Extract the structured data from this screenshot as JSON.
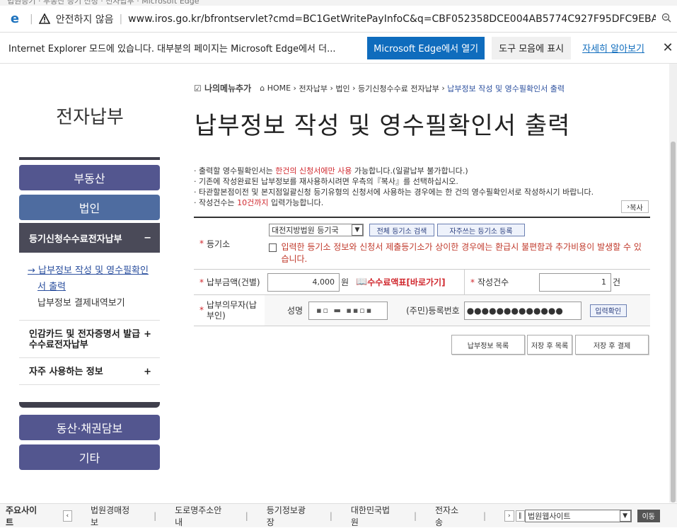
{
  "browser": {
    "tab_title": "법원등기 · 부동산 등기 신청 · 전자납부 · Microsoft Edge",
    "insecure": "안전하지 않음",
    "url": "www.iros.go.kr/bfrontservlet?cmd=BC1GetWritePayInfoC&q=CBF052358DCE004AB5774C927F95DFC9EBA18C3AF28..."
  },
  "iebar": {
    "message": "Internet Explorer 모드에 있습니다. 대부분의 페이지는 Microsoft Edge에서 더...",
    "open_edge": "Microsoft Edge에서 열기",
    "show_toolbar": "도구 모음에 표시",
    "learn_more": "자세히 알아보기"
  },
  "sidebar": {
    "title": "전자납부",
    "items": [
      "부동산",
      "법인"
    ],
    "sub_header": "등기신청수수료전자납부",
    "sub_items": [
      "납부정보 작성 및 영수필확인",
      "서 출력",
      "납부정보 결제내역보기"
    ],
    "more": [
      "인감카드 및 전자증명서 발급수수료전자납부",
      "자주 사용하는 정보"
    ],
    "bottom": [
      "동산·채권담보",
      "기타"
    ]
  },
  "breadcrumb": {
    "mymenu": "나의메뉴추가",
    "items": [
      "HOME",
      "전자납부",
      "법인",
      "등기신청수수료 전자납부"
    ],
    "current": "납부정보 작성 및 영수필확인서 출력"
  },
  "page_title": "납부정보 작성 및 영수필확인서 출력",
  "notes": {
    "n1a": "· 출력할 영수필확인서는 ",
    "n1b": "한건의 신청서에만 사용",
    "n1c": " 가능합니다.(일괄납부 불가합니다.)",
    "n2": "· 기존에 작성완료된 납부정보를 재사용하시려면 우측의『복사』를 선택하십시오.",
    "n3": "· 타관할본점이전 및 본지점일괄신청 등기유형의 신청서에 사용하는 경우에는 한 건의 영수필확인서로 작성하시기 바랍니다.",
    "n4a": "· 작성건수는 ",
    "n4b": "10건까지",
    "n4c": " 입력가능합니다."
  },
  "copy_button": "복사",
  "form": {
    "registry_label": "등기소",
    "registry_value": "대전지방법원  등기국",
    "search_all": "전체 등기소 검색",
    "register_freq": "자주쓰는 등기소 등록",
    "warning": "입력한 등기소 정보와 신청서 제출등기소가 상이한 경우에는 환급시 불편함과 추가비용이 발생할 수 있습니다.",
    "amount_label": "납부금액(건별)",
    "amount_value": "4,000",
    "won": "원",
    "fee_table": "수수료액표[바로가기]",
    "count_label": "작성건수",
    "count_value": "1",
    "count_unit": "건",
    "payer_label": "납부의무자(납부인)",
    "name_label": "성명",
    "id_label": "(주민)등록번호",
    "id_value": "●●●●●●●●●●●●●",
    "confirm": "입력확인"
  },
  "buttons": {
    "payment_list": "납부정보 목록",
    "save_list": "저장 후 목록",
    "save_pay": "저장 후 결제"
  },
  "footer": {
    "label": "주요사이트",
    "links": [
      "법원경매정보",
      "도로명주소안내",
      "등기정보광장",
      "대한민국법원",
      "전자소송"
    ],
    "select": "법원웹사이트",
    "go": "이동"
  }
}
